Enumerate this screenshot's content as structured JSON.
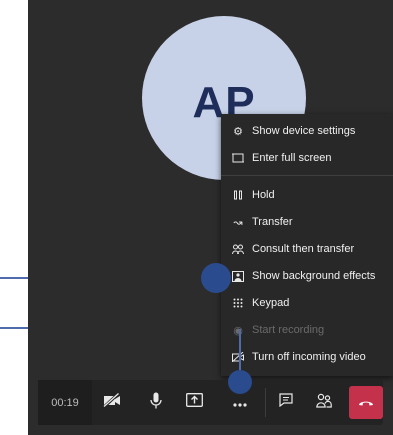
{
  "avatar": {
    "initials": "AP"
  },
  "menu": {
    "items": [
      {
        "label": "Show device settings",
        "icon": "gear-icon"
      },
      {
        "label": "Enter full screen",
        "icon": "fullscreen-icon"
      },
      {
        "label": "Hold",
        "icon": "pause-icon"
      },
      {
        "label": "Transfer",
        "icon": "transfer-icon"
      },
      {
        "label": "Consult then transfer",
        "icon": "consult-icon"
      },
      {
        "label": "Show background effects",
        "icon": "background-effects-icon"
      },
      {
        "label": "Keypad",
        "icon": "keypad-icon"
      },
      {
        "label": "Start recording",
        "icon": "record-icon",
        "disabled": true
      },
      {
        "label": "Turn off incoming video",
        "icon": "video-off-icon"
      }
    ]
  },
  "controls": {
    "timer": "00:19",
    "buttons": [
      "camera-off-icon",
      "microphone-icon",
      "share-screen-icon",
      "more-options-icon",
      "chat-icon",
      "participants-icon",
      "hang-up-icon"
    ]
  },
  "colors": {
    "stage_bg": "#2d2c2c",
    "menu_bg": "#292828",
    "avatar_bg": "#c7d2e8",
    "avatar_text": "#1f2d5a",
    "hangup": "#c4314b",
    "callout": "#2b4b8f"
  }
}
